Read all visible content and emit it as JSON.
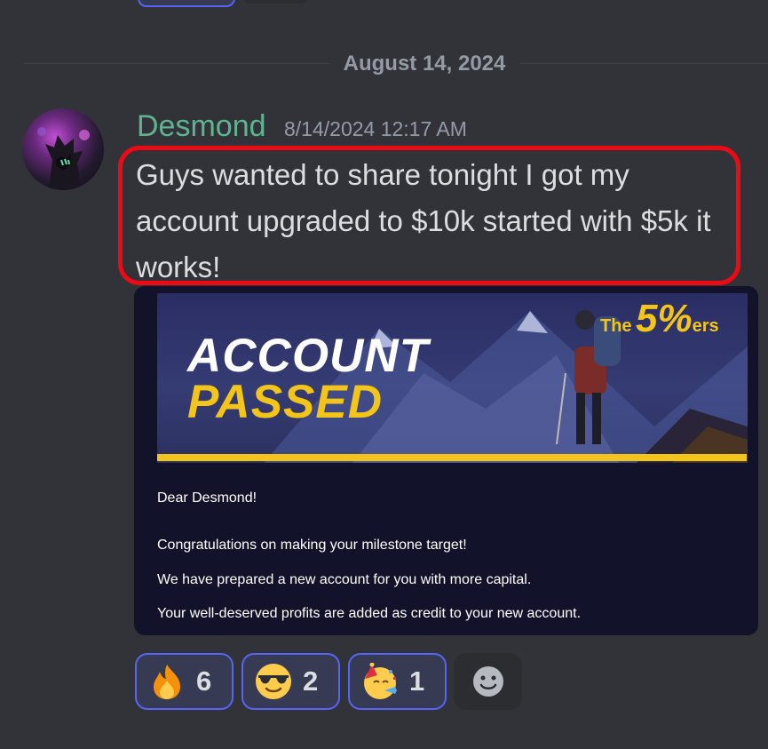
{
  "date_divider": "August 14, 2024",
  "message": {
    "author": "Desmond",
    "timestamp": "8/14/2024 12:17 AM",
    "text": "Guys wanted to share tonight I got my account upgraded to $10k started with $5k it works!"
  },
  "attachment": {
    "brand_the": "The",
    "brand_number": "5%",
    "brand_ers": "ers",
    "title_line1": "ACCOUNT",
    "title_line2": "PASSED",
    "greeting": "Dear Desmond!",
    "lines": [
      "Congratulations on making your milestone target!",
      "We have prepared a new account for you with more capital.",
      "Your well-deserved profits are added as credit to your new account."
    ]
  },
  "reactions": [
    {
      "emoji": "fire-icon",
      "count": "6"
    },
    {
      "emoji": "sunglasses-face-icon",
      "count": "2"
    },
    {
      "emoji": "party-face-icon",
      "count": "1"
    }
  ],
  "colors": {
    "background": "#313338",
    "author": "#5fb38f",
    "highlight": "#ee0a15",
    "reaction_border": "#5865f2",
    "brand_yellow": "#f3c419"
  }
}
